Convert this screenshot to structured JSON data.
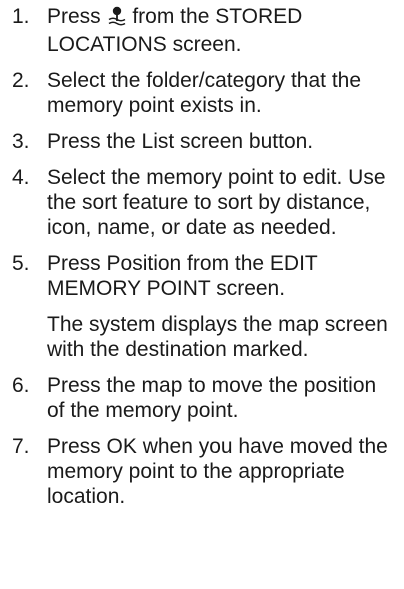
{
  "steps": [
    {
      "number": "1.",
      "before_icon": "Press ",
      "icon": "memory-point-icon",
      "after_icon": " from the STORED LOCATIONS screen."
    },
    {
      "number": "2.",
      "text": "Select the folder/category that the memory point exists in."
    },
    {
      "number": "3.",
      "text": "Press the List screen button."
    },
    {
      "number": "4.",
      "text": "Select the memory point to edit. Use the sort feature to sort by distance, icon, name, or date as needed."
    },
    {
      "number": "5.",
      "text": "Press Position from the EDIT MEMORY POINT screen.",
      "note": "The system displays the map screen with the destination marked."
    },
    {
      "number": "6.",
      "text": "Press the map to move the position of the memory point."
    },
    {
      "number": "7.",
      "text": "Press OK when you have moved the memory point to the appropriate location."
    }
  ]
}
